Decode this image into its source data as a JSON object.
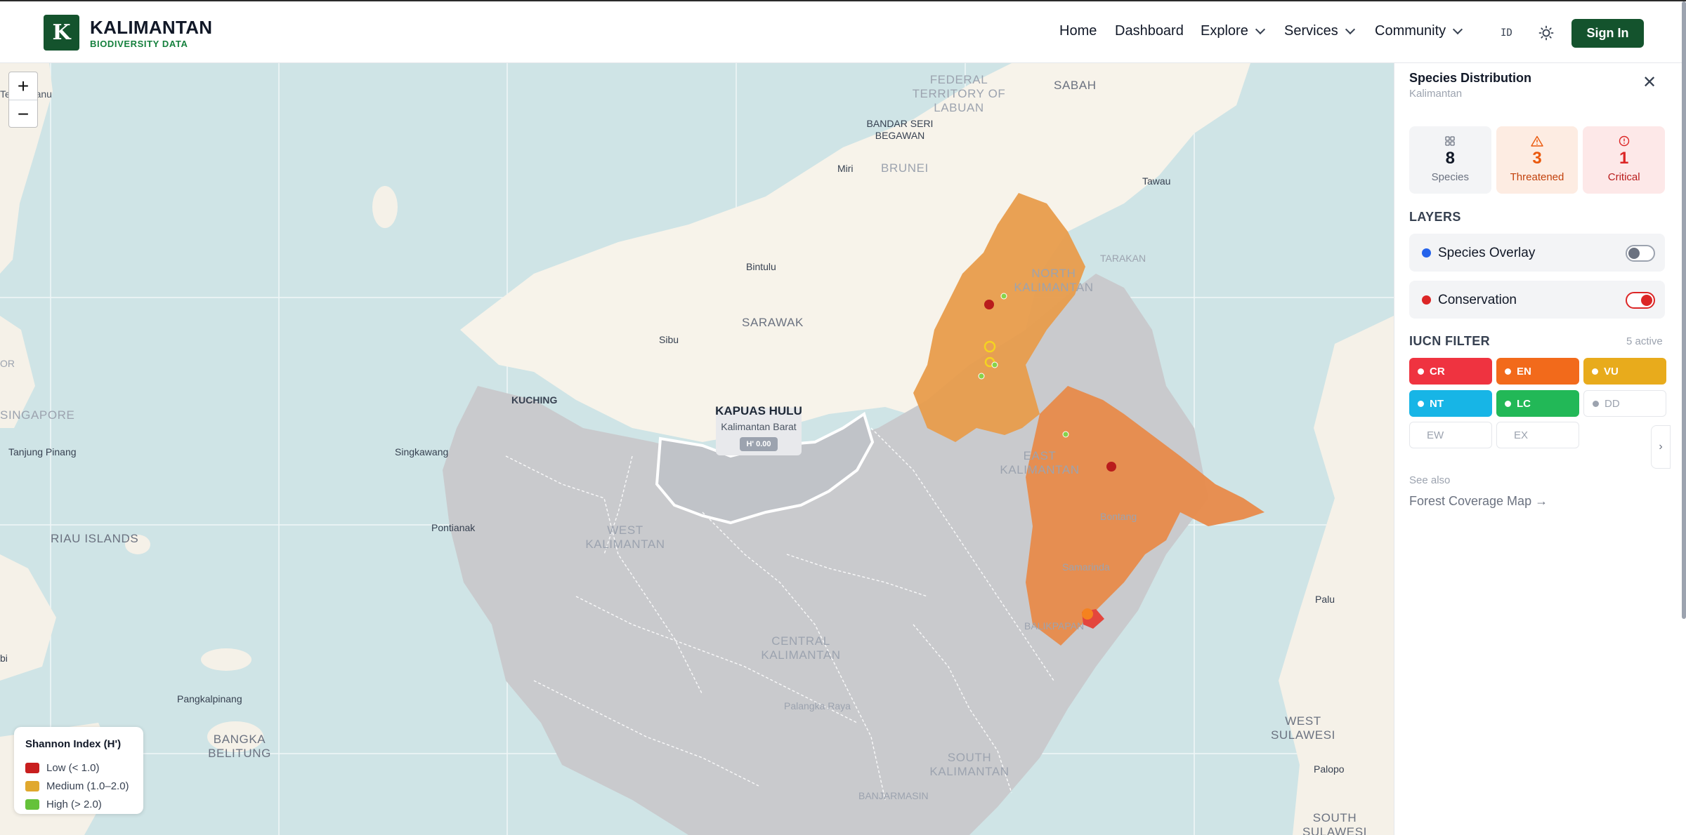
{
  "brand": {
    "logo_letter": "K",
    "title": "KALIMANTAN",
    "subtitle": "BIODIVERSITY DATA"
  },
  "nav": {
    "items": [
      {
        "label": "Home",
        "has_dropdown": false
      },
      {
        "label": "Dashboard",
        "has_dropdown": false
      },
      {
        "label": "Explore",
        "has_dropdown": true
      },
      {
        "label": "Services",
        "has_dropdown": true
      },
      {
        "label": "Community",
        "has_dropdown": true
      }
    ],
    "lang": "ID",
    "theme_icon": "sun-icon",
    "sign_in": "Sign In"
  },
  "map": {
    "zoom_in": "+",
    "zoom_out": "−",
    "places": [
      "Terengganu",
      "FEDERAL TERRITORY OF LABUAN",
      "SABAH",
      "BANDAR SERI BEGAWAN",
      "Miri",
      "BRUNEI",
      "Tawau",
      "Bintulu",
      "SARAWAK",
      "Sibu",
      "KUCHING",
      "SINGAPORE",
      "Tanjung Pinang",
      "Singkawang",
      "RIAU ISLANDS",
      "Pontianak",
      "WEST KALIMANTAN",
      "CENTRAL KALIMANTAN",
      "EAST KALIMANTAN",
      "NORTH KALIMANTAN",
      "TARAKAN",
      "Bontang",
      "Samarinda",
      "BALIKPAPAN",
      "Palu",
      "Pangkalpinang",
      "BANGKA BELITUNG",
      "Palangka Raya",
      "SOUTH KALIMANTAN",
      "BANJARMASIN",
      "WEST SULAWESI",
      "SOUTH SULAWESI",
      "Palopo",
      "OR",
      "bi"
    ],
    "tooltip": {
      "title": "KAPUAS HULU",
      "subtitle": "Kalimantan Barat",
      "value": "H' 0.00"
    },
    "legend": {
      "title": "Shannon Index (H')",
      "items": [
        {
          "label": "Low (< 1.0)",
          "color": "#c81e1e"
        },
        {
          "label": "Medium (1.0–2.0)",
          "color": "#e0a82e"
        },
        {
          "label": "High (> 2.0)",
          "color": "#65c23a"
        }
      ]
    }
  },
  "panel": {
    "title": "Species Distribution",
    "subtitle": "Kalimantan",
    "close_icon": "close-icon",
    "stats": [
      {
        "value": "8",
        "label": "Species",
        "icon": "grid-icon",
        "color": "#111827",
        "bg": "#f3f4f6"
      },
      {
        "value": "3",
        "label": "Threatened",
        "icon": "warning-icon",
        "color": "#ea580c",
        "bg": "#fdece2"
      },
      {
        "value": "1",
        "label": "Critical",
        "icon": "alert-circle-icon",
        "color": "#dc2626",
        "bg": "#fde8e8"
      }
    ],
    "layers_title": "LAYERS",
    "layers": [
      {
        "label": "Species Overlay",
        "dot_color": "#2563eb",
        "on": false
      },
      {
        "label": "Conservation",
        "dot_color": "#dc2626",
        "on": true
      }
    ],
    "iucn_title": "IUCN FILTER",
    "iucn_active": "5 active",
    "iucn": [
      {
        "code": "CR",
        "color": "#ef3340",
        "on": true
      },
      {
        "code": "EN",
        "color": "#f26a1b",
        "on": true
      },
      {
        "code": "VU",
        "color": "#e8ab1c",
        "on": true
      },
      {
        "code": "NT",
        "color": "#17b5e6",
        "on": true
      },
      {
        "code": "LC",
        "color": "#22b857",
        "on": true
      },
      {
        "code": "DD",
        "color": "#9ca3af",
        "on": false
      },
      {
        "code": "EW",
        "color": "#9ca3af",
        "on": false
      },
      {
        "code": "EX",
        "color": "#9ca3af",
        "on": false
      }
    ],
    "see_also": "See also",
    "see_link": "Forest Coverage Map →"
  }
}
